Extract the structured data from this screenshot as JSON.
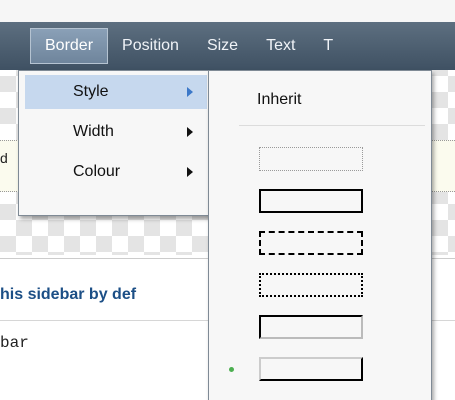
{
  "toolbar": {
    "items": [
      {
        "label": "Border",
        "active": true
      },
      {
        "label": "Position"
      },
      {
        "label": "Size"
      },
      {
        "label": "Text"
      },
      {
        "label": "T"
      }
    ]
  },
  "dropdown": {
    "items": [
      {
        "label": "Style",
        "highlighted": true
      },
      {
        "label": "Width"
      },
      {
        "label": "Colour"
      }
    ]
  },
  "submenu": {
    "inherit_label": "Inherit",
    "options": [
      {
        "style": "dotted-light"
      },
      {
        "style": "solid-thick"
      },
      {
        "style": "dashed"
      },
      {
        "style": "dotted"
      },
      {
        "style": "inset"
      },
      {
        "style": "outset",
        "selected": true
      }
    ]
  },
  "page": {
    "sidebar_heading": "his sidebar by def",
    "sidebar_code": "bar",
    "left_fragment": "d"
  },
  "colors": {
    "toolbar": "#4b5d6f",
    "highlight": "#c6d8ee",
    "selected_dot": "#4caf50",
    "heading": "#1c4f86"
  }
}
